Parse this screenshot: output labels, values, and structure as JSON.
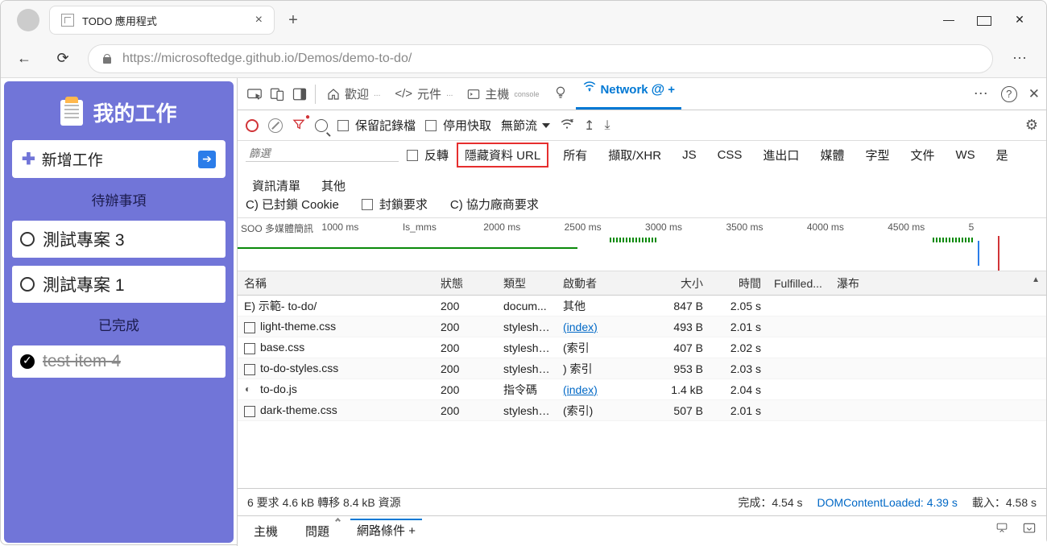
{
  "tab": {
    "title": "TODO 應用程式"
  },
  "url": "https://microsoftedge.github.io/Demos/demo-to-do/",
  "todo": {
    "title": "我的工作",
    "addLabel": "新增工作",
    "pendingLabel": "待辦事項",
    "doneLabel": "已完成",
    "items": [
      {
        "text": "測試專案 3",
        "done": false
      },
      {
        "text": "測試專案 1",
        "done": false
      }
    ],
    "doneItems": [
      {
        "text": "test item 4",
        "done": true
      }
    ]
  },
  "devtools": {
    "tabs": {
      "welcome": "歡迎",
      "elements": "元件",
      "console": "主機",
      "network": "Network"
    },
    "toolbar": {
      "preserve": "保留記錄檔",
      "disableCache": "停用快取",
      "throttle": "無節流"
    },
    "filters": {
      "filterPlaceholder": "篩選",
      "invert": "反轉",
      "hideData": "隱藏資料 URL",
      "all": "所有",
      "fetch": "擷取/XHR",
      "js": "JS",
      "css": "CSS",
      "import": "進出口",
      "media": "媒體",
      "font": "字型",
      "doc": "文件",
      "ws": "WS",
      "is": "是",
      "manifest": "資訊清單",
      "other": "其他",
      "blockedCookies": "C) 已封鎖 Cookie",
      "blockedReq": "封鎖要求",
      "thirdParty": "C) 協力廠商要求"
    },
    "headers": {
      "name": "名稱",
      "status": "狀態",
      "type": "類型",
      "initiator": "啟動者",
      "size": "大小",
      "time": "時間",
      "fulfilled": "Fulfilled...",
      "waterfall": "瀑布"
    },
    "rows": [
      {
        "name": "E) 示範- to-do/",
        "status": "200",
        "type": "docum...",
        "initiator": "其他",
        "initLink": false,
        "size": "847 B",
        "time": "2.05 s",
        "wfLeft": 2,
        "wfWidth": 44,
        "icon": "doc"
      },
      {
        "name": "light-theme.css",
        "status": "200",
        "type": "styleshe...",
        "initiator": "(index)",
        "initLink": true,
        "size": "493 B",
        "time": "2.01 s",
        "wfLeft": 50,
        "wfWidth": 45,
        "icon": "css"
      },
      {
        "name": "base.css",
        "status": "200",
        "type": "styleshe...",
        "initiator": "(索引",
        "initLink": false,
        "size": "407 B",
        "time": "2.02 s",
        "wfLeft": 50,
        "wfWidth": 46,
        "icon": "css"
      },
      {
        "name": "to-do-styles.css",
        "status": "200",
        "type": "styleshe...",
        "initiator": ") 索引",
        "initLink": false,
        "size": "953 B",
        "time": "2.03 s",
        "wfLeft": 50,
        "wfWidth": 47,
        "icon": "css"
      },
      {
        "name": "to-do.js",
        "status": "200",
        "type": "指令碼",
        "initiator": "(index)",
        "initLink": true,
        "size": "1.4 kB",
        "time": "2.04 s",
        "wfLeft": 50,
        "wfWidth": 48,
        "icon": "js"
      },
      {
        "name": "dark-theme.css",
        "status": "200",
        "type": "styleshe...",
        "initiator": "(索引)",
        "initLink": false,
        "size": "507 B",
        "time": "2.01 s",
        "wfLeft": 58,
        "wfWidth": 42,
        "icon": "css"
      }
    ],
    "timeline_ticks": [
      "SOO 多媒體簡訊",
      "1000 ms",
      "Is_mms",
      "2000 ms",
      "2500 ms",
      "3000 ms",
      "3500 ms",
      "4000 ms",
      "4500 ms",
      "5"
    ],
    "summary": {
      "requests": "6 要求 4.6 kB 轉移 8.4 kB 資源",
      "finish": "完成：4.54 s",
      "dcl": "DOMContentLoaded: 4.39 s",
      "load": "載入：4.58 s"
    },
    "drawer": {
      "console": "主機",
      "issues": "問題",
      "network": "網路條件 +"
    }
  }
}
